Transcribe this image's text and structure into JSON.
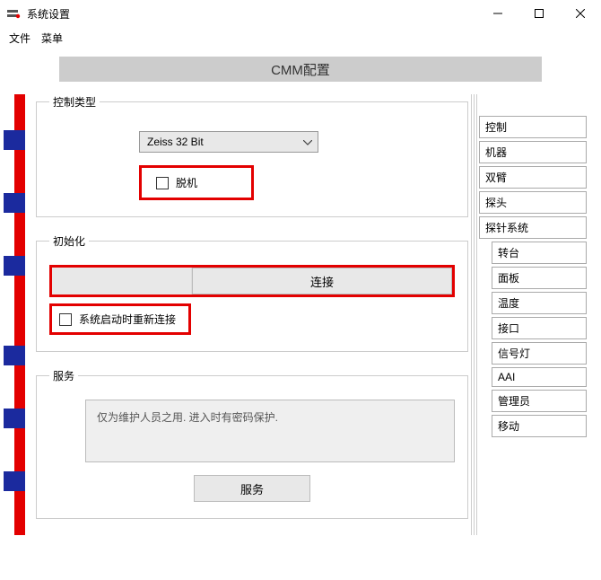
{
  "window": {
    "title": "系统设置"
  },
  "menu": {
    "file": "文件",
    "menu": "菜单"
  },
  "header": {
    "label": "CMM配置"
  },
  "control_group": {
    "legend": "控制类型",
    "dropdown_value": "Zeiss 32 Bit",
    "offline_label": "脱机"
  },
  "init_group": {
    "legend": "初始化",
    "connect_btn": "连接",
    "reconnect_label": "系统启动时重新连接"
  },
  "service_group": {
    "legend": "服务",
    "hint": "仅为维护人员之用. 进入时有密码保护.",
    "service_btn": "服务"
  },
  "side_tabs": {
    "t0": "控制",
    "t1": "机器",
    "t2": "双臂",
    "t3": "探头",
    "t4": "探针系统",
    "t5": "转台",
    "t6": "面板",
    "t7": "温度",
    "t8": "接口",
    "t9": "信号灯",
    "t10": "AAI",
    "t11": "管理员",
    "t12": "移动"
  }
}
